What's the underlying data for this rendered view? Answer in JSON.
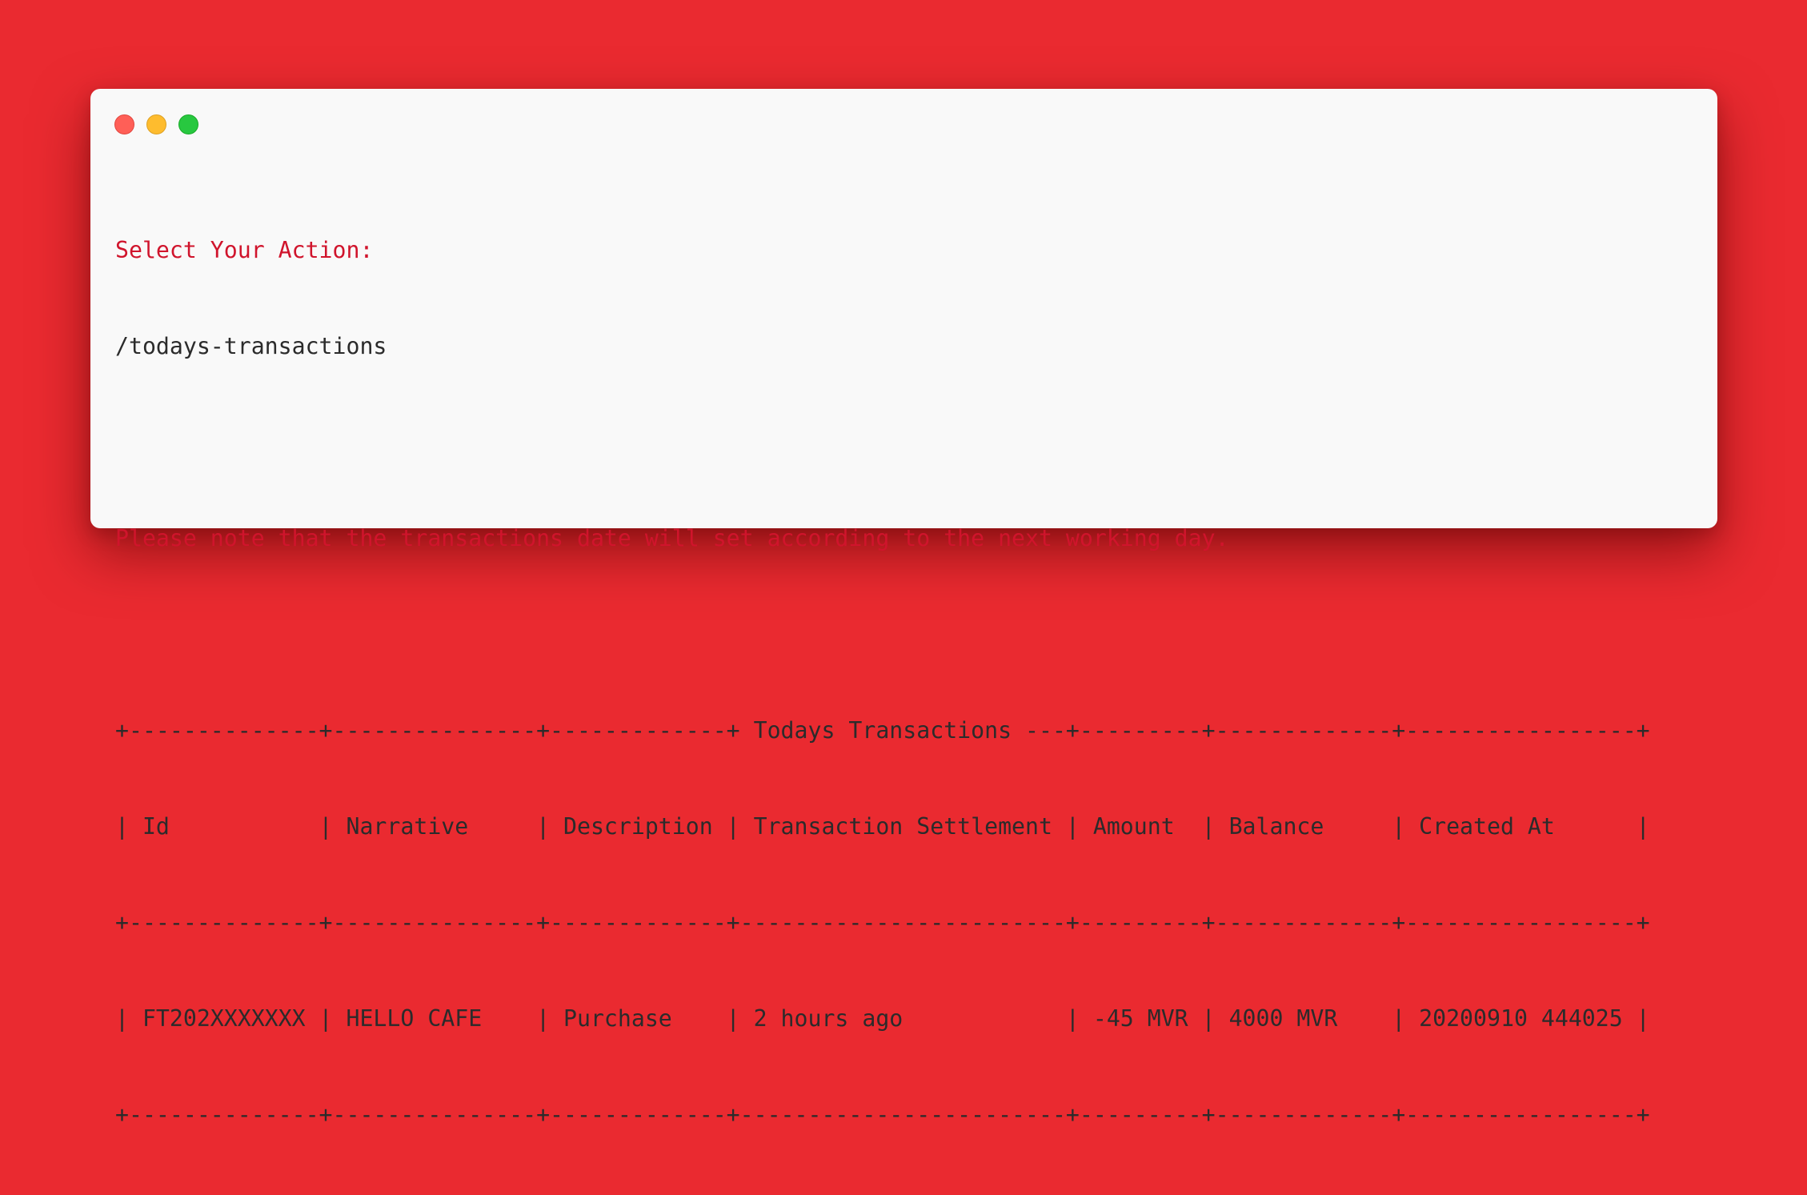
{
  "window": {
    "controls": {
      "close": "close-button",
      "minimize": "minimize-button",
      "maximize": "maximize-button"
    }
  },
  "colors": {
    "background": "#ea2a30",
    "window": "#f9f9f9",
    "accent_text": "#d0142c",
    "text": "#2b2b2b"
  },
  "terminal": {
    "prompt": "Select Your Action:",
    "command": "/todays-transactions",
    "notice": "Please note that the transactions date will set according to the next working day.",
    "table": {
      "top_border": "+--------------+---------------+-------------+ Todays Transactions ---+---------+-------------+-----------------+",
      "header_row": "| Id           | Narrative     | Description | Transaction Settlement | Amount  | Balance     | Created At      |",
      "separator": "+--------------+---------------+-------------+------------------------+---------+-------------+-----------------+",
      "rows": [
        "| FT202XXXXXXX | HELLO CAFE    | Purchase    | 2 hours ago            | -45 MVR | 4000 MVR    | 20200910 444025 |"
      ],
      "bottom_border": "+--------------+---------------+-------------+------------------------+---------+-------------+-----------------+"
    }
  }
}
